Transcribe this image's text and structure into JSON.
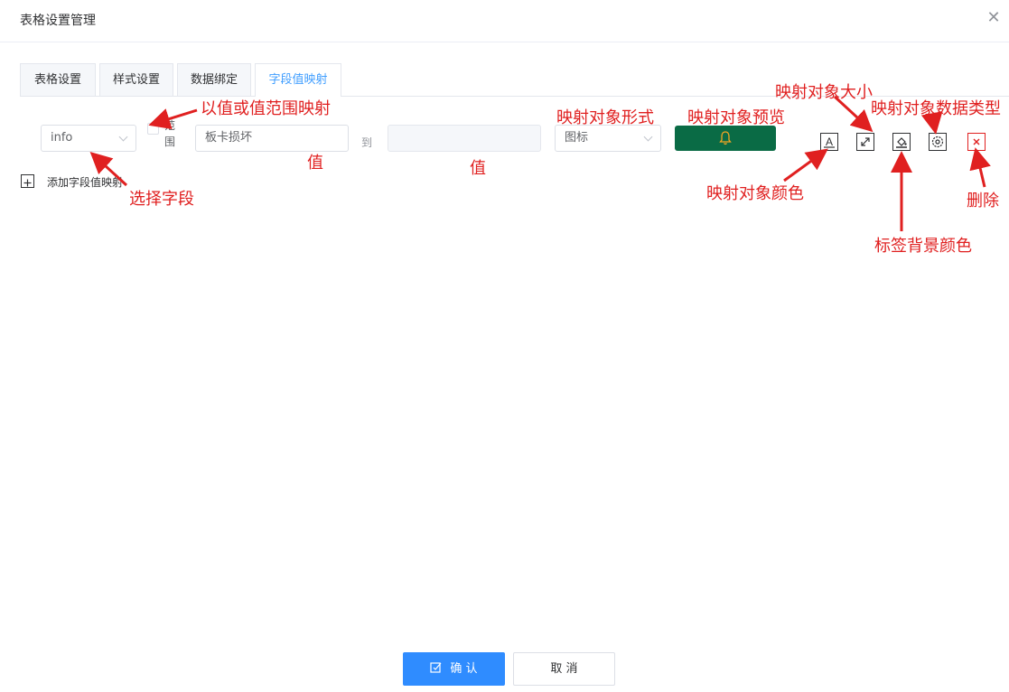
{
  "dialog": {
    "title": "表格设置管理",
    "close_glyph": "✕"
  },
  "tabs": [
    {
      "label": "表格设置",
      "active": false
    },
    {
      "label": "样式设置",
      "active": false
    },
    {
      "label": "数据绑定",
      "active": false
    },
    {
      "label": "字段值映射",
      "active": true
    }
  ],
  "mapping_row": {
    "field_select": {
      "value": "info"
    },
    "range_checkbox": {
      "label": "范围",
      "checked": false
    },
    "value_from": {
      "value": "板卡损坏"
    },
    "to_label": "到",
    "value_to": {
      "value": ""
    },
    "form_select": {
      "value": "图标"
    },
    "preview": {
      "icon": "bell-icon",
      "background": "#0a6b45",
      "icon_color": "#f5a623"
    },
    "icon_buttons": [
      {
        "name": "text-color-icon",
        "glyph": "A"
      },
      {
        "name": "expand-icon",
        "glyph": "⤢"
      },
      {
        "name": "fill-color-icon",
        "glyph": "paint-bucket"
      },
      {
        "name": "settings-icon",
        "glyph": "gear"
      },
      {
        "name": "delete-icon",
        "glyph": "x",
        "color": "#e02020"
      }
    ]
  },
  "add_mapping": {
    "label": "添加字段值映射",
    "glyph": "+"
  },
  "annotations": {
    "range_mapping": "以值或值范围映射",
    "value_1": "值",
    "value_2": "值",
    "mapping_form": "映射对象形式",
    "mapping_preview": "映射对象预览",
    "mapping_size": "映射对象大小",
    "mapping_data_type": "映射对象数据类型",
    "mapping_color": "映射对象颜色",
    "delete": "删除",
    "label_bg_color": "标签背景颜色",
    "select_field": "选择字段"
  },
  "footer": {
    "confirm_label": "确 认",
    "cancel_label": "取 消"
  },
  "colors": {
    "accent": "#409eff",
    "primary_button": "#2f8cff",
    "annotation": "#e02020"
  }
}
